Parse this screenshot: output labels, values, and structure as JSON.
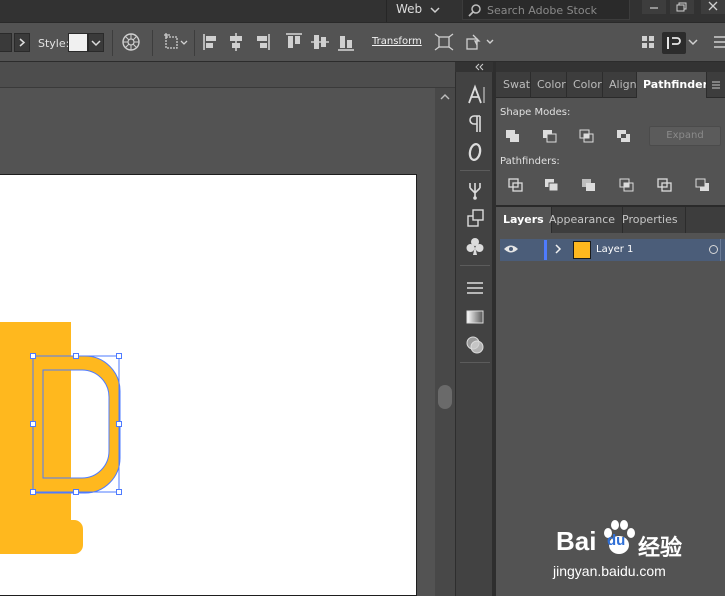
{
  "app_bar": {
    "workspace_label": "Web",
    "search_placeholder": "Search Adobe Stock"
  },
  "control_bar": {
    "style_label": "Style:",
    "transform_label": "Transform"
  },
  "pathfinder_panel": {
    "tabs": [
      "Swatc",
      "Color",
      "Color",
      "Align",
      "Pathfinder"
    ],
    "active_tab": "Pathfinder",
    "shape_modes_label": "Shape Modes:",
    "pathfinders_label": "Pathfinders:",
    "expand_label": "Expand"
  },
  "layers_panel": {
    "tabs": [
      "Layers",
      "Appearance",
      "Properties"
    ],
    "active_tab": "Layers",
    "layers": [
      {
        "name": "Layer 1",
        "color": "#4e7bff",
        "thumb_color": "#ffb81e"
      }
    ]
  },
  "artwork": {
    "fill_color": "#ffb81e"
  },
  "watermark": {
    "brand_a": "Bai",
    "brand_b": "du",
    "brand_cn": "经验",
    "site": "jingyan.baidu.com"
  }
}
